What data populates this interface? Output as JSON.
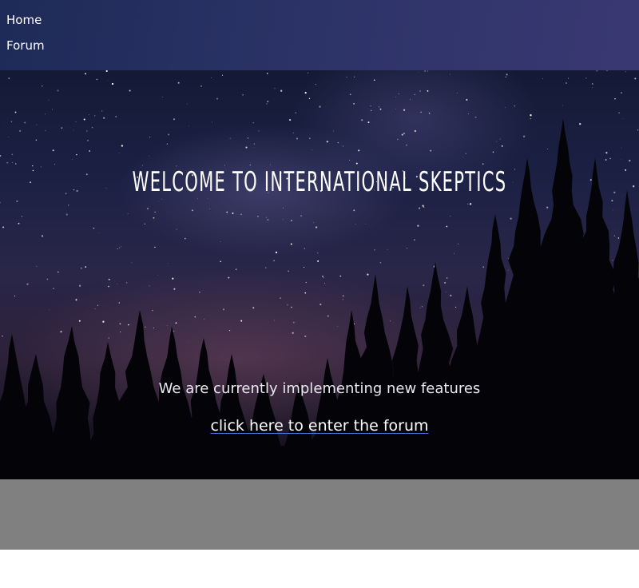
{
  "nav": {
    "items": [
      {
        "label": "Home"
      },
      {
        "label": "Forum"
      }
    ]
  },
  "hero": {
    "title": "WELCOME TO INTERNATIONAL SKEPTICS",
    "subtitle": "We are currently implementing new features",
    "forum_link": "click here to enter the forum"
  },
  "colors": {
    "nav_background": "#2b3366",
    "footer_band": "#808080",
    "link_underline": "#4a6fd8"
  }
}
